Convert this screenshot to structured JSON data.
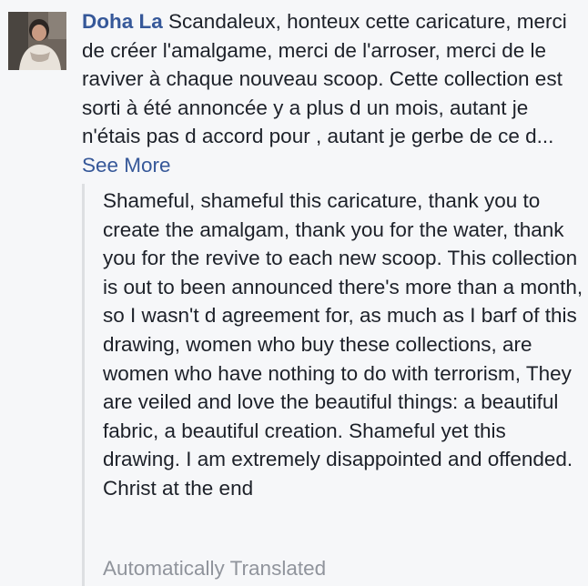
{
  "comment": {
    "author": "Doha La",
    "original_text": "Scandaleux, honteux cette caricature, merci de créer l'amalgame, merci de l'arroser, merci de le raviver à chaque nouveau scoop. Cette collection est sorti à été annoncée y a plus d un mois, autant je n'étais pas d accord pour , autant je gerbe de ce d...",
    "see_more_label": "See More",
    "avatar_icon": "profile-photo",
    "translation": {
      "text": "Shameful, shameful this caricature, thank you to create the amalgam, thank you for the water, thank you for the revive to each new scoop. This collection is out to been announced there's more than a month, so I wasn't d agreement for, as much as I barf of this drawing, women who buy these collections, are women who have nothing to do with terrorism, They are veiled and love the beautiful things: a beautiful fabric, a beautiful creation. Shameful yet this drawing. I am extremely disappointed and offended. Christ at the end",
      "label": "Automatically Translated"
    }
  },
  "colors": {
    "link": "#365899",
    "text": "#1d2129",
    "muted": "#90949c",
    "border": "#dddfe2",
    "background": "#f6f7f9"
  }
}
